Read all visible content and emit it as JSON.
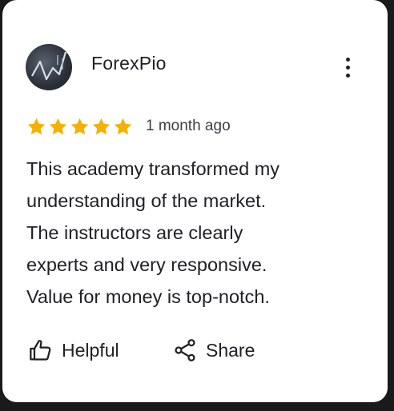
{
  "review": {
    "reviewer_name": "ForexPio",
    "rating": 5,
    "rating_max": 5,
    "time_ago": "1 month ago",
    "text_lines": [
      "This academy transformed my",
      "understanding of the market.",
      "The instructors are clearly",
      "experts and very responsive.",
      "Value for money is top-notch."
    ]
  },
  "actions": {
    "helpful_label": "Helpful",
    "share_label": "Share"
  },
  "icons": {
    "menu": "more-vert-icon",
    "helpful": "thumb-up-icon",
    "share": "share-icon",
    "star": "star-icon"
  },
  "colors": {
    "star": "#F6B100",
    "text": "#202124",
    "background": "#FFFFFF"
  }
}
